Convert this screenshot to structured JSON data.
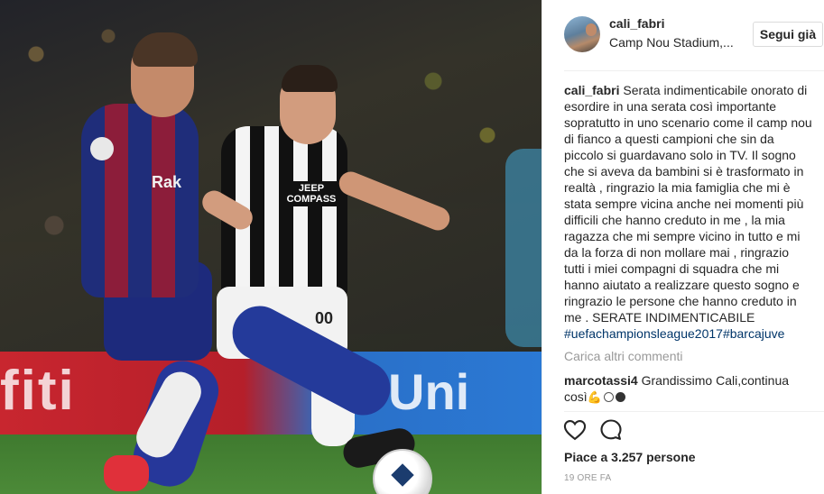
{
  "photo": {
    "sponsor_left": "Rak",
    "sponsor_center": "JEEP COMPASS",
    "shirt_number": "00",
    "board_left": "fiti",
    "board_right": "Uni"
  },
  "post": {
    "username": "cali_fabri",
    "location": "Camp Nou Stadium,...",
    "follow_label": "Segui già",
    "caption_author": "cali_fabri",
    "caption_text": "Serata indimenticabile onorato di esordire in una serata così importante sopratutto in uno scenario come il camp nou di fianco a questi campioni che sin da piccolo si guardavano solo in TV. Il sogno che si aveva da bambini si è trasformato in realtà , ringrazio la mia famiglia che mi è stata sempre vicina anche nei momenti più difficili che hanno creduto in me , la mia ragazza che mi sempre vicino in tutto e mi da la forza di non mollare mai , ringrazio tutti i miei compagni di squadra che mi hanno aiutato a realizzare questo sogno e ringrazio le persone che hanno creduto in me . SERATE INDIMENTICABILE",
    "hashtag_1": "#uefachampionsleague2017",
    "hashtag_2": "#barcajuve",
    "load_more_label": "Carica altri commenti",
    "comments": [
      {
        "author": "marcotassi4",
        "text": "Grandissimo Cali,continua così",
        "emoji": "💪"
      }
    ],
    "likes_text": "Piace a 3.257 persone",
    "timestamp": "19 ORE FA"
  },
  "icons": {
    "like": "heart-icon",
    "comment": "comment-icon"
  }
}
